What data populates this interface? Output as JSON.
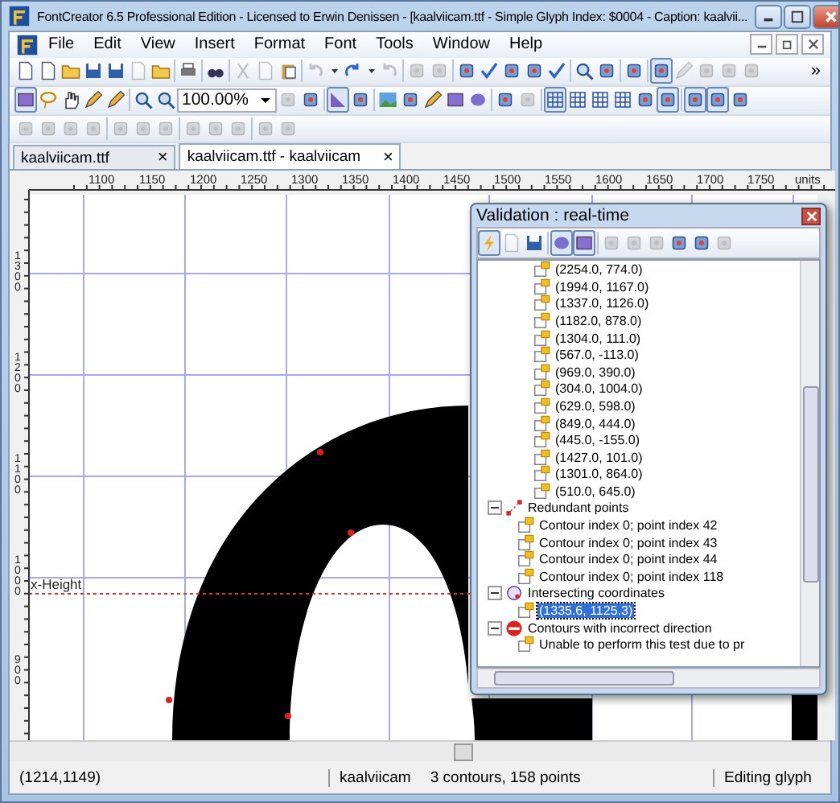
{
  "window": {
    "title": "FontCreator 6.5 Professional Edition - Licensed to Erwin Denissen - [kaalviicam.ttf - Simple Glyph Index: $0004 - Caption: kaalvii..."
  },
  "menu": [
    "File",
    "Edit",
    "View",
    "Insert",
    "Format",
    "Font",
    "Tools",
    "Window",
    "Help"
  ],
  "toolbars": [
    [
      {
        "kind": "document",
        "disabled": false,
        "pressed": false
      },
      {
        "kind": "document",
        "disabled": false,
        "pressed": false
      },
      {
        "kind": "folder",
        "disabled": false,
        "pressed": false
      },
      {
        "kind": "disk",
        "disabled": false,
        "pressed": false
      },
      {
        "kind": "disk",
        "disabled": false,
        "pressed": false
      },
      {
        "kind": "document",
        "disabled": true,
        "pressed": false
      },
      {
        "kind": "folder",
        "disabled": false,
        "pressed": false
      },
      {
        "kind": "separator"
      },
      {
        "kind": "printer",
        "disabled": false,
        "pressed": false
      },
      {
        "kind": "separator"
      },
      {
        "kind": "binoculars",
        "disabled": false,
        "pressed": false
      },
      {
        "kind": "separator"
      },
      {
        "kind": "scissors",
        "disabled": true,
        "pressed": false
      },
      {
        "kind": "document",
        "disabled": true,
        "pressed": false
      },
      {
        "kind": "clipboard",
        "disabled": false,
        "pressed": false
      },
      {
        "kind": "separator"
      },
      {
        "kind": "undo",
        "disabled": true,
        "pressed": false
      },
      {
        "kind": "dropdown",
        "disabled": false,
        "pressed": false
      },
      {
        "kind": "redo",
        "disabled": false,
        "pressed": false
      },
      {
        "kind": "dropdown",
        "disabled": false,
        "pressed": false
      },
      {
        "kind": "undo",
        "disabled": true,
        "pressed": false
      },
      {
        "kind": "separator"
      },
      {
        "kind": "tool",
        "disabled": true,
        "pressed": false
      },
      {
        "kind": "tool",
        "disabled": true,
        "pressed": false
      },
      {
        "kind": "separator"
      },
      {
        "kind": "tool",
        "disabled": false,
        "pressed": false
      },
      {
        "kind": "check",
        "disabled": false,
        "pressed": false
      },
      {
        "kind": "tool",
        "disabled": false,
        "pressed": false
      },
      {
        "kind": "tool",
        "disabled": false,
        "pressed": false
      },
      {
        "kind": "check",
        "disabled": false,
        "pressed": false
      },
      {
        "kind": "separator"
      },
      {
        "kind": "magnifier",
        "disabled": false,
        "pressed": false
      },
      {
        "kind": "tool",
        "disabled": false,
        "pressed": false
      },
      {
        "kind": "separator"
      },
      {
        "kind": "tool",
        "disabled": false,
        "pressed": false
      },
      {
        "kind": "separator"
      },
      {
        "kind": "tool",
        "disabled": false,
        "pressed": true
      },
      {
        "kind": "pen",
        "disabled": true,
        "pressed": false
      },
      {
        "kind": "tool",
        "disabled": true,
        "pressed": false
      },
      {
        "kind": "tool",
        "disabled": true,
        "pressed": false
      },
      {
        "kind": "tool",
        "disabled": true,
        "pressed": false
      }
    ],
    [
      {
        "kind": "square",
        "disabled": false,
        "pressed": true
      },
      {
        "kind": "lasso",
        "disabled": false,
        "pressed": false
      },
      {
        "kind": "hand",
        "disabled": false,
        "pressed": false
      },
      {
        "kind": "pen",
        "disabled": false,
        "pressed": false
      },
      {
        "kind": "pen",
        "disabled": false,
        "pressed": false
      },
      {
        "kind": "separator"
      },
      {
        "kind": "magnifier",
        "disabled": false,
        "pressed": false
      },
      {
        "kind": "magnifier",
        "disabled": false,
        "pressed": false
      },
      {
        "kind": "combo",
        "value": "100.00%"
      },
      {
        "kind": "tool",
        "disabled": true,
        "pressed": false
      },
      {
        "kind": "tool",
        "disabled": false,
        "pressed": false
      },
      {
        "kind": "separator"
      },
      {
        "kind": "pointer",
        "disabled": false,
        "pressed": true
      },
      {
        "kind": "tool",
        "disabled": false,
        "pressed": false
      },
      {
        "kind": "separator"
      },
      {
        "kind": "picture",
        "disabled": false,
        "pressed": false
      },
      {
        "kind": "tool",
        "disabled": false,
        "pressed": false
      },
      {
        "kind": "pen",
        "disabled": false,
        "pressed": false
      },
      {
        "kind": "square",
        "disabled": false,
        "pressed": false
      },
      {
        "kind": "circle",
        "disabled": false,
        "pressed": false
      },
      {
        "kind": "separator"
      },
      {
        "kind": "tool",
        "disabled": false,
        "pressed": false
      },
      {
        "kind": "tool",
        "disabled": true,
        "pressed": false
      },
      {
        "kind": "separator"
      },
      {
        "kind": "grid",
        "disabled": false,
        "pressed": true
      },
      {
        "kind": "grid",
        "disabled": false,
        "pressed": false
      },
      {
        "kind": "grid",
        "disabled": false,
        "pressed": false
      },
      {
        "kind": "grid",
        "disabled": false,
        "pressed": false
      },
      {
        "kind": "tool",
        "disabled": false,
        "pressed": false
      },
      {
        "kind": "tool",
        "disabled": false,
        "pressed": true
      },
      {
        "kind": "separator"
      },
      {
        "kind": "tool",
        "disabled": false,
        "pressed": true
      },
      {
        "kind": "tool",
        "disabled": false,
        "pressed": true
      },
      {
        "kind": "tool",
        "disabled": false,
        "pressed": false
      }
    ],
    [
      {
        "kind": "tool",
        "disabled": true,
        "pressed": false
      },
      {
        "kind": "tool",
        "disabled": true,
        "pressed": false
      },
      {
        "kind": "tool",
        "disabled": true,
        "pressed": false
      },
      {
        "kind": "tool",
        "disabled": true,
        "pressed": false
      },
      {
        "kind": "separator"
      },
      {
        "kind": "tool",
        "disabled": true,
        "pressed": false
      },
      {
        "kind": "tool",
        "disabled": true,
        "pressed": false
      },
      {
        "kind": "tool",
        "disabled": true,
        "pressed": false
      },
      {
        "kind": "separator"
      },
      {
        "kind": "tool",
        "disabled": true,
        "pressed": false
      },
      {
        "kind": "tool",
        "disabled": true,
        "pressed": false
      },
      {
        "kind": "tool",
        "disabled": true,
        "pressed": false
      },
      {
        "kind": "separator"
      },
      {
        "kind": "tool",
        "disabled": true,
        "pressed": false
      },
      {
        "kind": "tool",
        "disabled": true,
        "pressed": false
      }
    ]
  ],
  "toolbar_overflow": "»",
  "tabs": [
    {
      "label": "kaalviicam.ttf",
      "selected": false,
      "close": "×"
    },
    {
      "label": "kaalviicam.ttf - kaalviicam",
      "selected": true,
      "close": "×"
    }
  ],
  "ruler": {
    "labels": [
      "1100",
      "1150",
      "1200",
      "1250",
      "1300",
      "1350",
      "1400",
      "1450",
      "1500",
      "1550",
      "1600",
      "1650",
      "1700",
      "1750"
    ],
    "units": "units",
    "vertical_labels": [
      "1300",
      "1200",
      "1100",
      "1000",
      "900"
    ]
  },
  "guideline": {
    "label": "x-Height"
  },
  "validation": {
    "title": "Validation : real-time",
    "toolbar": [
      {
        "kind": "lightning",
        "disabled": false,
        "pressed": true
      },
      {
        "kind": "document",
        "disabled": true,
        "pressed": false
      },
      {
        "kind": "disk",
        "disabled": false,
        "pressed": false
      },
      {
        "kind": "separator"
      },
      {
        "kind": "circle",
        "disabled": false,
        "pressed": true
      },
      {
        "kind": "square",
        "disabled": false,
        "pressed": true
      },
      {
        "kind": "separator"
      },
      {
        "kind": "tool",
        "disabled": true,
        "pressed": false
      },
      {
        "kind": "tool",
        "disabled": true,
        "pressed": false
      },
      {
        "kind": "tool",
        "disabled": true,
        "pressed": false
      },
      {
        "kind": "tool",
        "disabled": false,
        "pressed": false
      },
      {
        "kind": "tool",
        "disabled": false,
        "pressed": false
      },
      {
        "kind": "tool",
        "disabled": true,
        "pressed": false
      }
    ],
    "continued_items": [
      {
        "label": "(2254.0, 774.0)",
        "selected": false
      },
      {
        "label": "(1994.0, 1167.0)",
        "selected": false
      },
      {
        "label": "(1337.0, 1126.0)",
        "selected": false
      },
      {
        "label": "(1182.0, 878.0)",
        "selected": false
      },
      {
        "label": "(1304.0, 111.0)",
        "selected": false
      },
      {
        "label": "(567.0, -113.0)",
        "selected": false
      },
      {
        "label": "(969.0, 390.0)",
        "selected": false
      },
      {
        "label": "(304.0, 1004.0)",
        "selected": false
      },
      {
        "label": "(629.0, 598.0)",
        "selected": false
      },
      {
        "label": "(849.0, 444.0)",
        "selected": false
      },
      {
        "label": "(445.0, -155.0)",
        "selected": false
      },
      {
        "label": "(1427.0, 101.0)",
        "selected": false
      },
      {
        "label": "(1301.0, 864.0)",
        "selected": false
      },
      {
        "label": "(510.0, 645.0)",
        "selected": false
      }
    ],
    "categories": [
      {
        "label": "Redundant points",
        "kind": "points",
        "expanded": true,
        "children": [
          {
            "label": "Contour index 0; point index 42",
            "selected": false
          },
          {
            "label": "Contour index 0; point index 43",
            "selected": false
          },
          {
            "label": "Contour index 0; point index 44",
            "selected": false
          },
          {
            "label": "Contour index 0; point index 118",
            "selected": false
          }
        ]
      },
      {
        "label": "Intersecting coordinates",
        "kind": "intersect",
        "expanded": true,
        "children": [
          {
            "label": "(1335.6, 1125.3)",
            "selected": true
          }
        ]
      },
      {
        "label": "Contours with incorrect direction",
        "kind": "error",
        "expanded": true,
        "children": [
          {
            "label": "Unable to perform this test due to pr",
            "selected": false
          }
        ]
      }
    ]
  },
  "status_bar": {
    "coordinates": "(1214,1149)",
    "glyph": "kaalviicam",
    "info": "3 contours, 158 points",
    "mode": "Editing glyph"
  }
}
